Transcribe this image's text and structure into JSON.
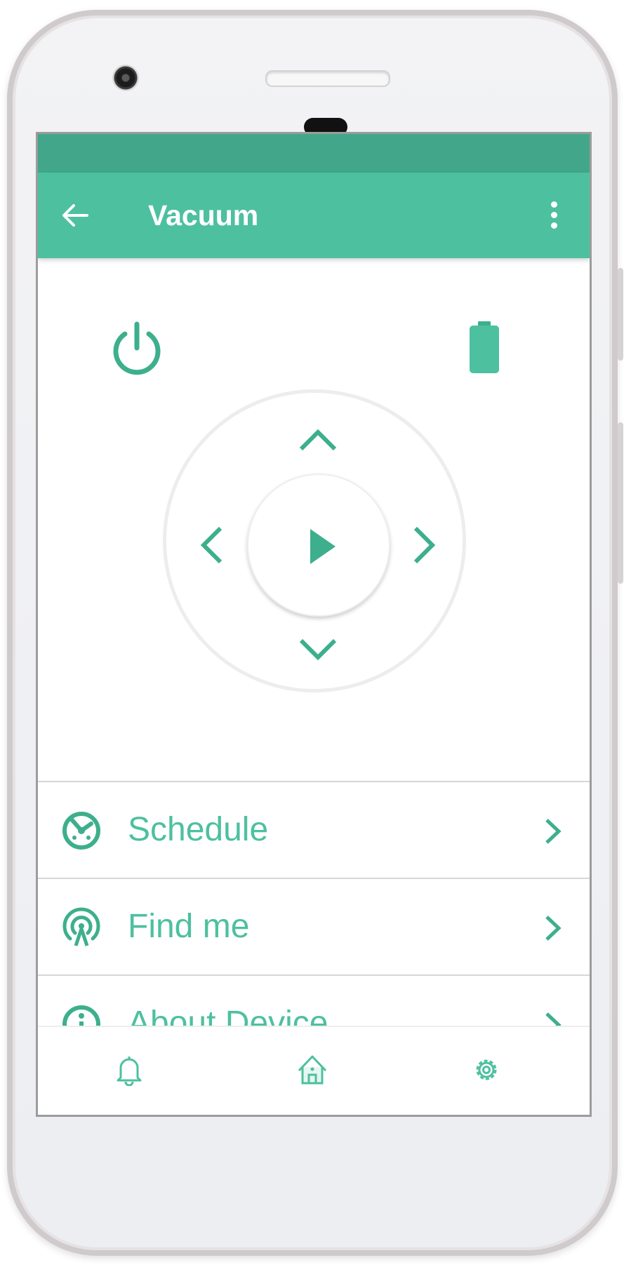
{
  "appbar": {
    "title": "Vacuum"
  },
  "list": {
    "items": [
      {
        "label": "Schedule",
        "icon": "schedule-icon"
      },
      {
        "label": "Find me",
        "icon": "find-me-icon"
      },
      {
        "label": "About Device",
        "icon": "info-icon"
      }
    ]
  },
  "bottom_nav": {
    "items": [
      {
        "icon": "bell-icon",
        "active": false
      },
      {
        "icon": "home-icon",
        "active": true
      },
      {
        "icon": "gear-icon",
        "active": false
      }
    ]
  },
  "colors": {
    "accent": "#4dc09f",
    "status_bar": "#42a78a",
    "icon_dark": "#3daf8c"
  }
}
